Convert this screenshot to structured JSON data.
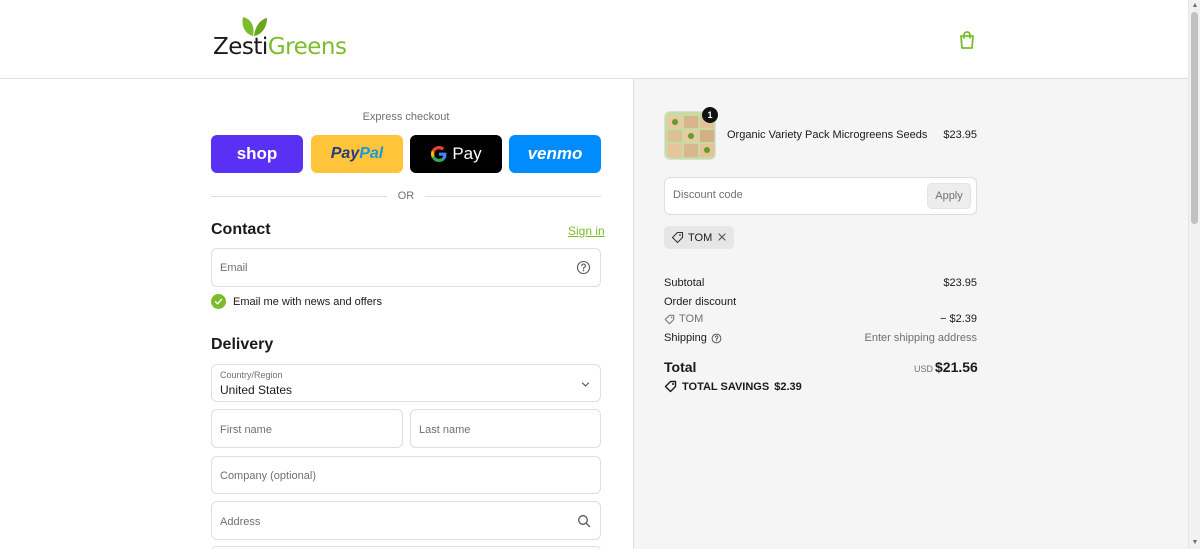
{
  "brand": {
    "name_part1": "Zesti",
    "name_part2": "Greens",
    "accent_color": "#7cbc2a"
  },
  "header": {
    "cart_icon": "shopping-bag-icon"
  },
  "express": {
    "title": "Express checkout",
    "buttons": {
      "shop": "shop",
      "paypal_1": "Pay",
      "paypal_2": "Pal",
      "gpay": "Pay",
      "venmo": "venmo"
    },
    "or": "OR"
  },
  "contact": {
    "title": "Contact",
    "signin": "Sign in",
    "email_placeholder": "Email",
    "newsletter_label": "Email me with news and offers",
    "newsletter_checked": true
  },
  "delivery": {
    "title": "Delivery",
    "country_label": "Country/Region",
    "country_value": "United States",
    "first_name": "First name",
    "last_name": "Last name",
    "company": "Company (optional)",
    "address": "Address"
  },
  "order": {
    "item": {
      "name": "Organic Variety Pack Microgreens Seeds",
      "price": "$23.95",
      "quantity": "1"
    },
    "discount_placeholder": "Discount code",
    "apply_label": "Apply",
    "applied_code": "TOM",
    "subtotal_label": "Subtotal",
    "subtotal_value": "$23.95",
    "discount_label": "Order discount",
    "discount_code": "TOM",
    "discount_value": "− $2.39",
    "shipping_label": "Shipping",
    "shipping_value": "Enter shipping address",
    "total_label": "Total",
    "currency": "USD",
    "total_value": "$21.56",
    "savings_label": "TOTAL SAVINGS",
    "savings_value": "$2.39"
  }
}
